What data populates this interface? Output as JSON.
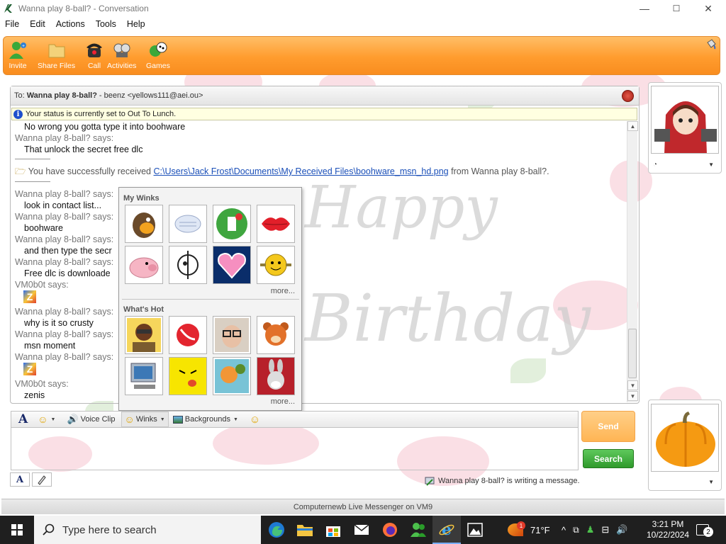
{
  "window": {
    "title": "Wanna play 8-ball? - Conversation",
    "controls": {
      "minimize": "—",
      "maximize": "☐",
      "close": "✕"
    }
  },
  "menu": [
    "File",
    "Edit",
    "Actions",
    "Tools",
    "Help"
  ],
  "toolbar": {
    "buttons": [
      {
        "label": "Invite",
        "icon": "invite-icon"
      },
      {
        "label": "Share Files",
        "icon": "folder-icon"
      },
      {
        "label": "Call",
        "icon": "phone-icon"
      },
      {
        "label": "Activities",
        "icon": "activities-icon"
      },
      {
        "label": "Games",
        "icon": "games-icon"
      }
    ]
  },
  "conversation": {
    "to_label": "To:",
    "contact_name": "Wanna play 8-ball?",
    "contact_detail": "- beenz <yellows111@aei.ou>",
    "status_text": "Your status is currently set to Out To Lunch.",
    "messages": [
      {
        "text": "No wrong you gotta type it into boohware",
        "kind": "body"
      },
      {
        "text": "Wanna play 8-ball? says:",
        "kind": "says"
      },
      {
        "text": "That unlock the secret free dlc",
        "kind": "body"
      },
      {
        "received_prefix": "You have successfully received ",
        "path": "C:\\Users\\Jack Frost\\Documents\\My Received Files\\boohware_msn_hd.png",
        "suffix": " from Wanna play 8-ball?."
      },
      {
        "text": "Wanna play 8-ball? says:",
        "kind": "says"
      },
      {
        "text": "look in contact list...",
        "kind": "body"
      },
      {
        "text": "Wanna play 8-ball? says:",
        "kind": "says"
      },
      {
        "text": "boohware",
        "kind": "body"
      },
      {
        "text": "Wanna play 8-ball? says:",
        "kind": "says"
      },
      {
        "text": "and then type the secr",
        "kind": "body"
      },
      {
        "text": "Wanna play 8-ball? says:",
        "kind": "says"
      },
      {
        "text": "Free dlc is downloade",
        "kind": "body"
      },
      {
        "text": "VM0b0t says:",
        "kind": "says"
      },
      {
        "text": "Wanna play 8-ball? says:",
        "kind": "says"
      },
      {
        "text": "why is it so crusty",
        "kind": "body"
      },
      {
        "text": "Wanna play 8-ball? says:",
        "kind": "says"
      },
      {
        "text": "msn moment",
        "kind": "body"
      },
      {
        "text": "Wanna play 8-ball? says:",
        "kind": "says"
      },
      {
        "text": "VM0b0t says:",
        "kind": "says"
      },
      {
        "text": "zenis",
        "kind": "body"
      }
    ]
  },
  "winks_popup": {
    "my_winks_title": "My Winks",
    "whats_hot_title": "What's Hot",
    "more": "more..."
  },
  "input_toolbar": {
    "voice_clip": "Voice Clip",
    "winks": "Winks",
    "backgrounds": "Backgrounds"
  },
  "buttons": {
    "send": "Send",
    "search": "Search"
  },
  "typing_status": "Wanna play 8-ball? is writing a message.",
  "footer": "Computernewb Live Messenger on VM9",
  "taskbar": {
    "search_placeholder": "Type here to search",
    "weather": "71°F",
    "weather_badge": "1",
    "time": "3:21 PM",
    "date": "10/22/2024",
    "notification_count": "2"
  },
  "colors": {
    "toolbar_orange": "#ff9c2e",
    "send_orange": "#ffb554",
    "search_green": "#2f9a2b",
    "link_blue": "#1a4fb8"
  }
}
